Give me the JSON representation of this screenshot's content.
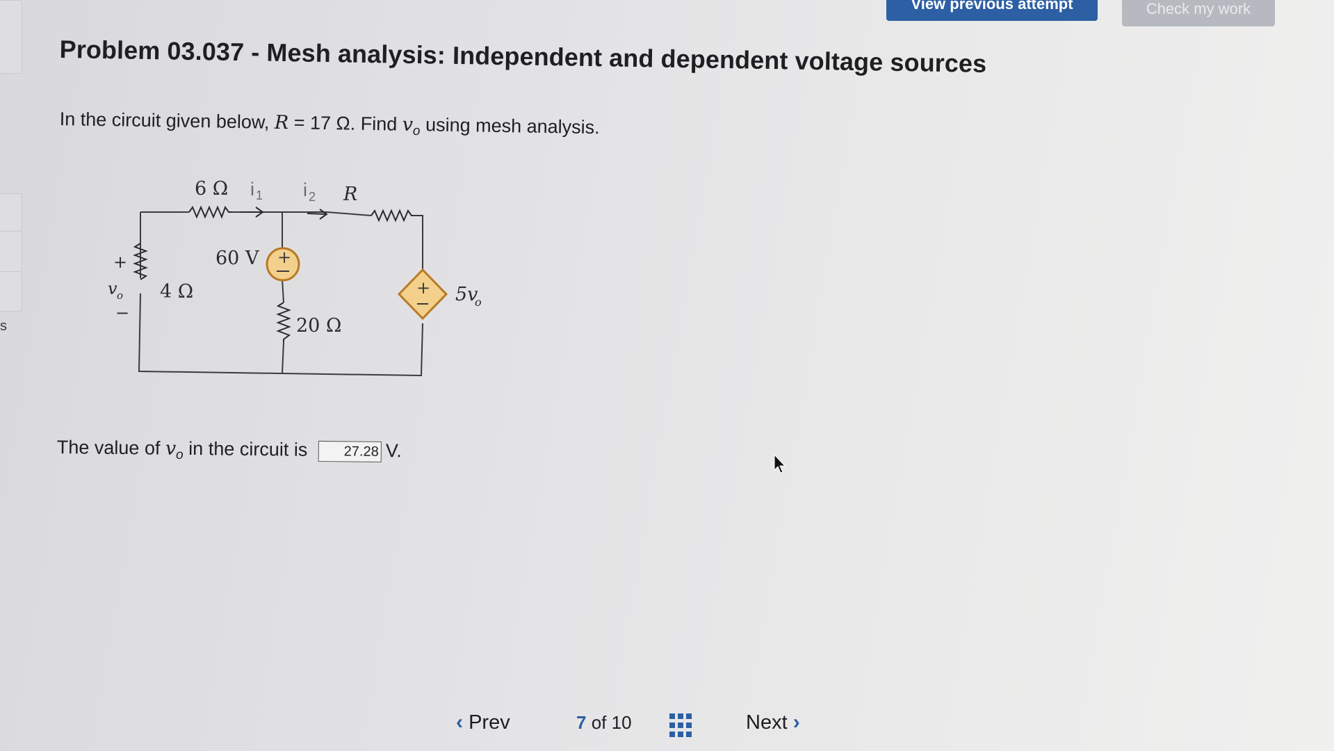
{
  "header": {
    "view_previous_attempt": "View previous attempt",
    "check_my_work": "Check my work"
  },
  "sidebar": {
    "edge_letter": "s"
  },
  "problem": {
    "title": "Problem 03.037 - Mesh analysis: Independent and dependent voltage sources",
    "prompt_prefix": "In the circuit given below, ",
    "prompt_var": "R",
    "prompt_value": " = 17 Ω. Find ",
    "prompt_v": "v",
    "prompt_sub": "o",
    "prompt_suffix": " using mesh analysis."
  },
  "circuit": {
    "r6": "6 Ω",
    "i1": "i",
    "i1_sub": "1",
    "i2": "i",
    "i2_sub": "2",
    "r_label": "R",
    "v60": "60 V",
    "r4": "4 Ω",
    "r20": "20 Ω",
    "dep_source": "5v",
    "dep_source_sub": "o",
    "vo_label": "v",
    "vo_sub": "o",
    "plus": "+",
    "minus": "−"
  },
  "answer": {
    "prefix": "The value of ",
    "v": "v",
    "sub": "o",
    "middle": " in the circuit is ",
    "value": "27.28",
    "unit": "V."
  },
  "nav": {
    "prev": "Prev",
    "current": "7",
    "of": "of",
    "total": "10",
    "next": "Next"
  },
  "colors": {
    "accent": "#2c5fa3",
    "source_fill": "#f3d08c",
    "source_stroke": "#b87a25"
  }
}
